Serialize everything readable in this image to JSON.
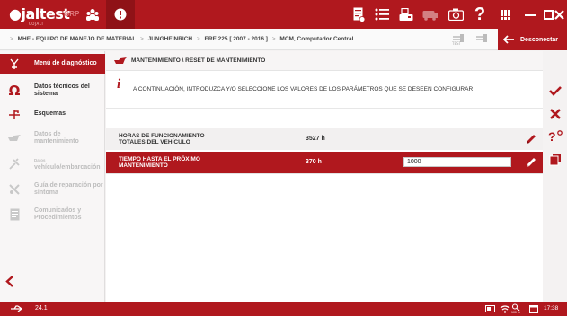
{
  "app": {
    "logo": "jaltest",
    "logo_sub": "COJALI",
    "grp_label": "GRP"
  },
  "breadcrumb": {
    "items": [
      "MHE - EQUIPO DE MANEJO DE MATERIAL",
      "JUNGHEINRICH",
      "ERE 225 [ 2007 - 2016 ]",
      "MCM, Computador Central"
    ],
    "separator": ">"
  },
  "disconnect_label": "Desconectar",
  "sidebar": {
    "items": [
      {
        "label": "Menú de diagnóstico",
        "icon": "diagnostic-menu-icon"
      },
      {
        "label": "Datos técnicos del sistema",
        "icon": "omega-icon"
      },
      {
        "label": "Esquemas",
        "icon": "schematics-icon"
      },
      {
        "label": "Datos de mantenimiento",
        "icon": "oil-can-icon"
      },
      {
        "label": "vehículo/embarcación",
        "icon": "wrench-screwdriver-icon",
        "prefix": "Datos"
      },
      {
        "label": "Guía de reparación por síntoma",
        "icon": "repair-guide-icon"
      },
      {
        "label": "Comunicados y Procedimientos",
        "icon": "document-icon"
      }
    ],
    "back_icon": "chevron-left-icon"
  },
  "main": {
    "title": "MANTENIMIENTO \\ RESET DE MANTENIMIENTO",
    "info_text": "A CONTINUACIÓN, INTRODUZCA Y/O SELECCIONE LOS VALORES DE LOS PARÁMETROS QUE SE DESEEN CONFIGURAR",
    "rows": [
      {
        "name_line1": "HORAS DE FUNCIONAMIENTO",
        "name_line2": "TOTALES DEL VEHÍCULO",
        "value": "3527 h"
      },
      {
        "name_line1": "TIEMPO HASTA EL PRÓXIMO",
        "name_line2": "MANTENIMIENTO",
        "value": "370 h",
        "input": "1000"
      }
    ]
  },
  "status": {
    "version": "24.1",
    "time": "17:38",
    "percent": "100 %"
  },
  "colors": {
    "brand_red": "#b0181e",
    "background": "#f4f2f2"
  }
}
